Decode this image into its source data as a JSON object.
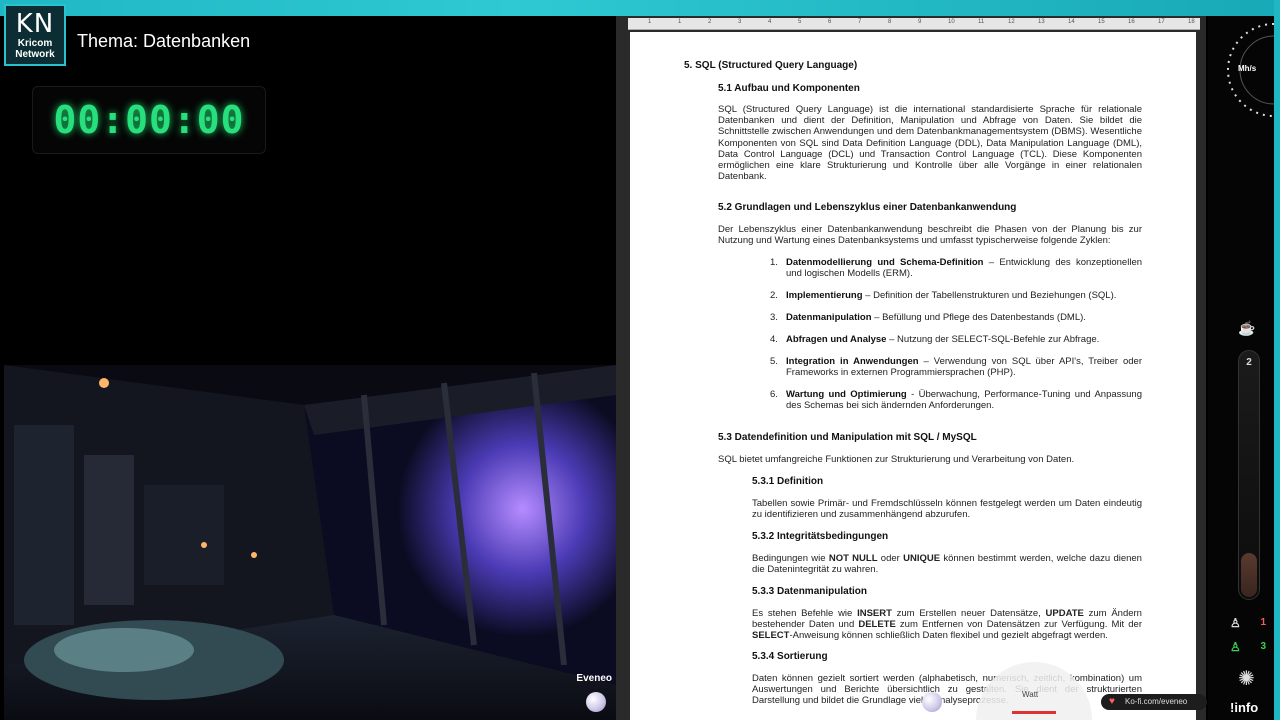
{
  "stream": {
    "logo_initials": "KN",
    "logo_line1": "Kricom",
    "logo_line2": "Network",
    "topic": "Thema: Datenbanken",
    "timer": "00:00:00",
    "scene_name": "Eveneo"
  },
  "document": {
    "ruler_numbers": [
      "1",
      "1",
      "2",
      "3",
      "4",
      "5",
      "6",
      "7",
      "8",
      "9",
      "10",
      "11",
      "12",
      "13",
      "14",
      "15",
      "16",
      "17",
      "18"
    ],
    "h_main": "5. SQL (Structured Query Language)",
    "h51": "5.1 Aufbau und Komponenten",
    "p51": "SQL (Structured Query Language) ist die international standardisierte Sprache für relationale Datenbanken und dient der Definition, Manipulation und Abfrage von Daten. Sie bildet die Schnittstelle zwischen Anwendungen und dem Datenbankmanagementsystem (DBMS). Wesentliche Komponenten von SQL sind Data Definition Language (DDL), Data Manipulation Language (DML), Data Control Language (DCL) und Transaction Control Language (TCL). Diese Komponenten ermöglichen eine klare Strukturierung und Kontrolle über alle Vorgänge in einer relationalen Datenbank.",
    "h52": "5.2 Grundlagen und Lebenszyklus einer Datenbankanwendung",
    "p52": "Der Lebenszyklus einer Datenbankanwendung beschreibt die Phasen von der Planung bis zur Nutzung und Wartung eines Datenbanksystems und umfasst typischerweise folgende Zyklen:",
    "list": [
      {
        "num": "1.",
        "bold": "Datenmodellierung und Schema-Definition",
        "text": " – Entwicklung des konzeptionellen und logischen Modells (ERM)."
      },
      {
        "num": "2.",
        "bold": "Implementierung",
        "text": " – Definition der Tabellenstrukturen und Beziehungen (SQL)."
      },
      {
        "num": "3.",
        "bold": "Datenmanipulation",
        "text": " – Befüllung und Pflege des Datenbestands (DML)."
      },
      {
        "num": "4.",
        "bold": "Abfragen und Analyse",
        "text": " – Nutzung der SELECT-SQL-Befehle zur Abfrage."
      },
      {
        "num": "5.",
        "bold": "Integration in Anwendungen",
        "text": " – Verwendung von SQL über API's, Treiber oder Frameworks in externen Programmiersprachen (PHP)."
      },
      {
        "num": "6.",
        "bold": "Wartung und Optimierung",
        "text": " - Überwachung, Performance-Tuning und Anpassung des Schemas bei sich ändernden Anforderungen."
      }
    ],
    "h53": "5.3 Datendefinition und Manipulation mit SQL / MySQL",
    "p53": "SQL bietet umfangreiche Funktionen zur Strukturierung und Verarbeitung von Daten.",
    "h531": "5.3.1 Definition",
    "p531": "Tabellen sowie Primär- und Fremdschlüsseln können festgelegt werden um Daten eindeutig zu identifizieren und zusammenhängend abzurufen.",
    "h532": "5.3.2 Integritätsbedingungen",
    "p532_pre": "Bedingungen wie ",
    "p532_b1": "NOT NULL",
    "p532_mid": " oder ",
    "p532_b2": "UNIQUE",
    "p532_post": " können bestimmt werden, welche dazu dienen die Datenintegrität zu wahren.",
    "h533": "5.3.3 Datenmanipulation",
    "p533_a": "Es stehen Befehle wie ",
    "p533_insert": "INSERT",
    "p533_b": " zum Erstellen neuer Datensätze, ",
    "p533_update": "UPDATE",
    "p533_c": " zum Ändern bestehender Daten und ",
    "p533_delete": "DELETE",
    "p533_d": " zum Entfernen von Datensätzen zur Verfügung. Mit der ",
    "p533_select": "SELECT",
    "p533_e": "-Anweisung können schließlich Daten flexibel und gezielt abgefragt werden.",
    "h534": "5.3.4 Sortierung",
    "p534": "Daten können gezielt sortiert werden (alphabetisch, numerisch, zeitlich, kombination) um Auswertungen und Berichte übersichtlich zu gestalten. Sie dient der strukturierten Darstellung und bildet die Grundlage vieler Analyseprozesse."
  },
  "hud": {
    "gauge_label": "Mh/s",
    "tube_level": "2",
    "tube_fill_fraction": 0.18,
    "viewers_1": "1",
    "viewers_2": "3",
    "info_label": "!info",
    "kofi": "Ko-fi.com/eveneo",
    "watt_label": "Watt"
  },
  "colors": {
    "accent": "#29c3cf",
    "timer": "#27e07d",
    "viewers_green": "#39d353",
    "viewers_red": "#ff5a5a"
  }
}
